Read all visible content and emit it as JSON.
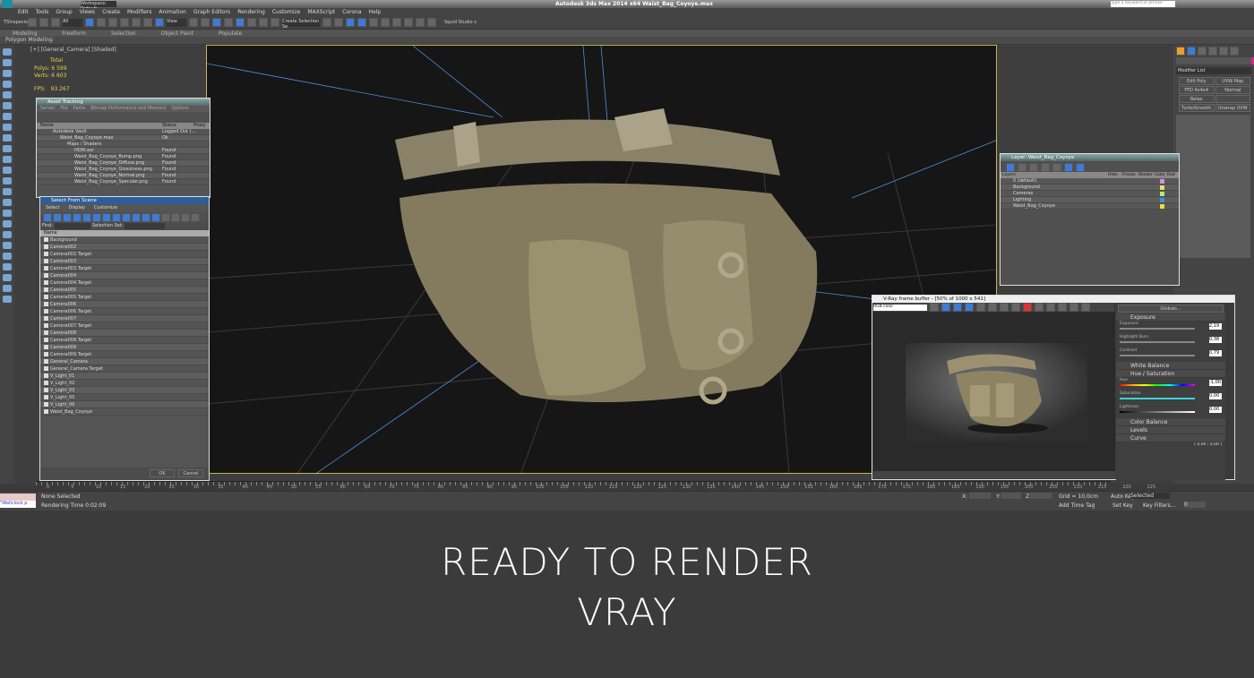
{
  "app": {
    "title": "Autodesk 3ds Max 2014 x64   Waist_Bag_Coyoye.max",
    "workspace": "Workspace: Default",
    "search_placeholder": "Type a keyword or phrase"
  },
  "menu": [
    "Edit",
    "Tools",
    "Group",
    "Views",
    "Create",
    "Modifiers",
    "Animation",
    "Graph Editors",
    "Rendering",
    "Customize",
    "MAXScript",
    "Corona",
    "Help"
  ],
  "toolbar": {
    "inspector": "TSInspector",
    "filter": "All",
    "view": "View",
    "selection_set": "Create Selection Se",
    "studio": "Squid Studio v"
  },
  "ribbon": {
    "tabs": [
      "Modeling",
      "Freeform",
      "Selection",
      "Object Paint",
      "Populate"
    ],
    "sub": "Polygon Modeling"
  },
  "viewport": {
    "label": "[+] [General_Camera] [Shaded]",
    "stats": {
      "total": "Total",
      "polys_label": "Polys:",
      "polys": "6 599",
      "verts_label": "Verts:",
      "verts": "6 603",
      "fps_label": "FPS:",
      "fps": "93.267"
    }
  },
  "asset_tracking": {
    "title": "Asset Tracking",
    "menu": [
      "Server",
      "File",
      "Paths",
      "Bitmap Performance and Memory",
      "Options"
    ],
    "columns": [
      "Name",
      "Status",
      "Proxy"
    ],
    "rows": [
      {
        "name": "Autodesk Vault",
        "status": "Logged Out (..."
      },
      {
        "name": "Waist_Bag_Coyoye.max",
        "status": "Ok"
      },
      {
        "name": "Maps / Shaders",
        "status": ""
      },
      {
        "name": "HDRI.exr",
        "status": "Found"
      },
      {
        "name": "Waist_Bag_Coyoye_Bump.png",
        "status": "Found"
      },
      {
        "name": "Waist_Bag_Coyoye_Diffuse.png",
        "status": "Found"
      },
      {
        "name": "Waist_Bag_Coyoye_Glossiness.png",
        "status": "Found"
      },
      {
        "name": "Waist_Bag_Coyoye_Normal.png",
        "status": "Found"
      },
      {
        "name": "Waist_Bag_Coyoye_Specular.png",
        "status": "Found"
      }
    ]
  },
  "select_scene": {
    "title": "Select From Scene",
    "menu": [
      "Select",
      "Display",
      "Customize"
    ],
    "find_label": "Find:",
    "selset_label": "Selection Set:",
    "column": "Name",
    "items": [
      "Background",
      "Camera002",
      "Camera002.Target",
      "Camera003",
      "Camera003.Target",
      "Camera004",
      "Camera004.Target",
      "Camera005",
      "Camera005.Target",
      "Camera006",
      "Camera006.Target",
      "Camera007",
      "Camera007.Target",
      "Camera008",
      "Camera008.Target",
      "Camera009",
      "Camera009.Target",
      "General_Camera",
      "General_Camera.Target",
      "V_Light_01",
      "V_Light_02",
      "V_Light_03",
      "V_Light_05",
      "V_Light_06",
      "Waist_Bag_Coyoye"
    ],
    "ok": "OK",
    "cancel": "Cancel"
  },
  "layer": {
    "title": "Layer: Waist_Bag_Coyoye",
    "columns": [
      "Layers",
      "",
      "Hide",
      "Freeze",
      "Render",
      "Color",
      "Rad"
    ],
    "rows": [
      {
        "name": "0 (default)",
        "color": "#d98ce0"
      },
      {
        "name": "Background",
        "color": "#d8e870"
      },
      {
        "name": "Cameras",
        "color": "#b8e870"
      },
      {
        "name": "Lighting",
        "color": "#3d8ee0"
      },
      {
        "name": "Waist_Bag_Coyoye",
        "color": "#e8e030"
      }
    ]
  },
  "cmd": {
    "modifier_list": "Modifier List",
    "buttons": [
      "Edit Poly",
      "UVW Map",
      "FFD 4x4x4",
      "Normal",
      "Relax",
      "",
      "TurboSmooth",
      "Unwrap UVW"
    ]
  },
  "vray": {
    "title": "V-Ray frame buffer - [50% of 1000 x 541]",
    "channel": "RGB color",
    "globals": "Globals...",
    "exposure": "Exposure",
    "exp_label": "Exposure",
    "exp_val": "2,19",
    "hb_label": "Highlight Burn",
    "hb_val": "0,38",
    "con_label": "Contrast",
    "con_val": "0,79",
    "white_balance": "White Balance",
    "hue_sat": "Hue / Saturation",
    "hue_label": "Hue",
    "hue_val": "-1,00",
    "sat_label": "Saturation",
    "sat_val": "0,00",
    "light_label": "Lightness",
    "light_val": "0,00",
    "color_balance": "Color Balance",
    "levels": "Levels",
    "curve": "Curve",
    "curve_val": "[ 0,00 ; 0,00 ]"
  },
  "timeline": {
    "ticks": [
      "0",
      "5",
      "10",
      "15",
      "20",
      "25",
      "30",
      "35",
      "40",
      "45",
      "50",
      "55",
      "60",
      "65",
      "70",
      "75",
      "80",
      "85",
      "90",
      "95",
      "100",
      "105",
      "110",
      "115",
      "120",
      "125",
      "130",
      "135",
      "140",
      "145",
      "150",
      "155",
      "160",
      "165",
      "170",
      "175",
      "180",
      "185",
      "190",
      "195",
      "200",
      "205",
      "210",
      "215",
      "220",
      "225"
    ]
  },
  "status": {
    "selection": "None Selected",
    "render_time": "Rendering Time  0:02:09",
    "maxscript": "\"Wallclock p",
    "x": "X:",
    "y": "Y:",
    "z": "Z:",
    "grid": "Grid = 10,0cm",
    "add_time_tag": "Add Time Tag",
    "auto_key": "Auto Key",
    "selected": "Selected",
    "set_key": "Set Key",
    "key_filters": "Key Filters...",
    "frame": "0"
  },
  "caption": {
    "line1": "READY TO RENDER",
    "line2": "VRAY"
  }
}
